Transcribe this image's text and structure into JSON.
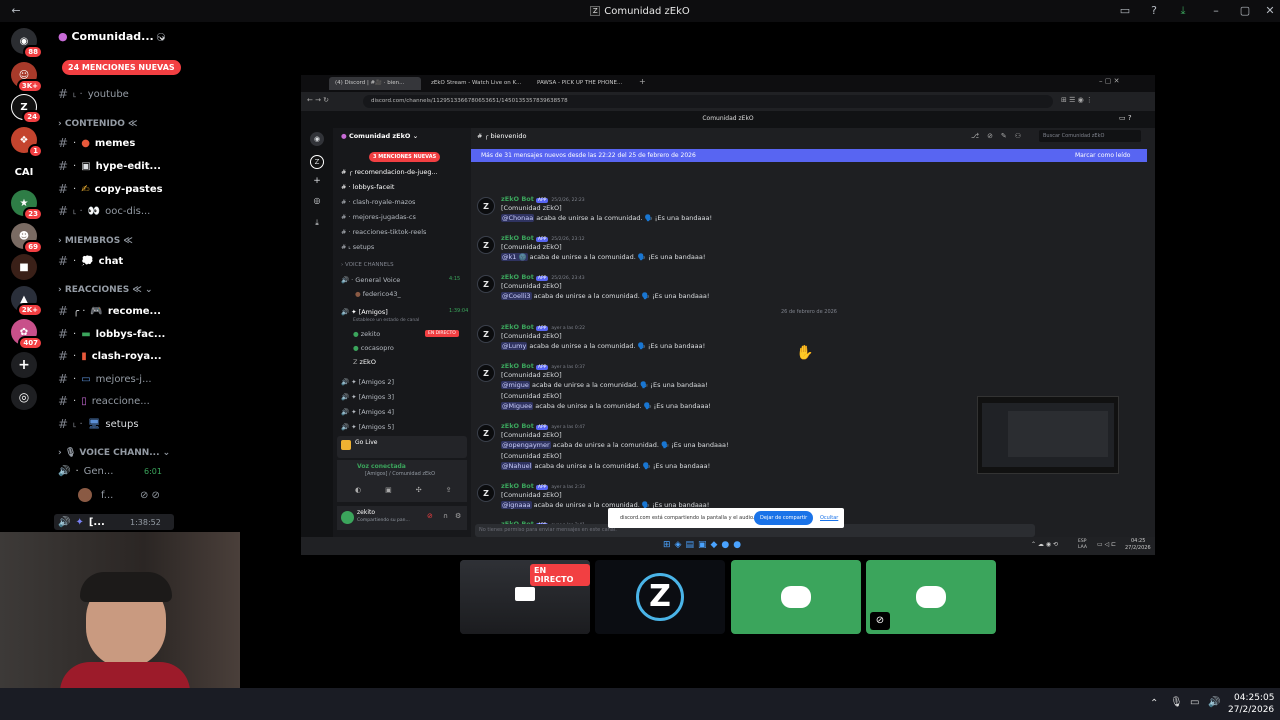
{
  "window": {
    "title": "Comunidad zEkO"
  },
  "server": {
    "name": "Comunidad...",
    "mentions_pill": "24 MENCIONES NUEVAS",
    "rail_badges": [
      "88",
      "3K+",
      "24",
      "1",
      "23",
      "69",
      "2K+",
      "407"
    ],
    "rail_text": "CAI"
  },
  "channels": {
    "youtube": "youtube",
    "cat_contenido": "CONTENIDO",
    "memes": "memes",
    "hype_edit": "hype-edit...",
    "copy_pastes": "copy-pastes",
    "ooc_dis": "ooc-dis...",
    "cat_miembros": "MIEMBROS",
    "chat": "chat",
    "cat_reacciones": "REACCIONES",
    "recome": "recome...",
    "lobbys_fac": "lobbys-fac...",
    "clash_roya": "clash-roya...",
    "mejores_j": "mejores-j...",
    "reaccione": "reaccione...",
    "setups": "setups",
    "cat_voice": "VOICE CHANN...",
    "gen": "Gen...",
    "gen_time": "6:01",
    "f_user": "f...",
    "amigos_short": "[...",
    "amigos_time": "1:38:52"
  },
  "shared": {
    "tabs": [
      "(4) Discord | #🎥 · bien...",
      "zEkO Stream - Watch Live on K...",
      "PAWSA - PICK UP THE PHONE..."
    ],
    "url": "discord.com/channels/1129513366780653651/1450135357839638578",
    "top_title": "Comunidad zEkO",
    "server_name": "Comunidad zEkO",
    "channel_title": "bienvenido",
    "search_placeholder": "Buscar Comunidad zEkO",
    "mentions_pill": "3 MENCIONES NUEVAS",
    "banner": "Más de 31 mensajes nuevos desde las 22:22 del 25 de febrero de 2026",
    "banner_action": "Marcar como leído",
    "date_divider": "26 de febrero de 2026",
    "channel_list": [
      "recomendacion-de-jueg...",
      "lobbys-faceit",
      "clash-royale-mazos",
      "mejores-jugadas-cs",
      "reacciones-tiktok-reels",
      "setups",
      "VOICE CHANNELS",
      "General Voice",
      "federico43_",
      "[Amigos]",
      "Establece un estado de canal",
      "zekito",
      "cocasopro",
      "zEkO",
      "[Amigos 2]",
      "[Amigos 3]",
      "[Amigos 4]",
      "[Amigos 5]"
    ],
    "general_voice_time": "4:15",
    "amigos_time": "1:39:04",
    "en_directo": "EN DIRECTO",
    "go_live": "Go Live",
    "voz_conectada": "Voz conectada",
    "voz_channel": "[Amigos] / Comunidad zEkO",
    "user_name": "zekito",
    "user_status": "Compartiendo su pan...",
    "input_placeholder": "No tienes permiso para enviar mensajes en este canal.",
    "share_notice": "discord.com está compartiendo la pantalla y el audio.",
    "share_stop": "Dejar de compartir",
    "share_hide": "Ocultar",
    "messages": [
      {
        "author": "zEkO Bot",
        "tag": "APP",
        "time": "25/2/26, 22:23",
        "lines": [
          [
            "[Comunidad zEkO]",
            ""
          ],
          [
            "@Chonaa",
            " acaba de unirse a la comunidad. 🗣️ ¡Es una bandaaa!"
          ]
        ]
      },
      {
        "author": "zEkO Bot",
        "tag": "APP",
        "time": "25/2/26, 23:12",
        "lines": [
          [
            "[Comunidad zEkO]",
            ""
          ],
          [
            "@k1 🌚",
            " acaba de unirse a la comunidad. 🗣️ ¡Es una bandaaa!"
          ]
        ]
      },
      {
        "author": "zEkO Bot",
        "tag": "APP",
        "time": "25/2/26, 23:43",
        "lines": [
          [
            "[Comunidad zEkO]",
            ""
          ],
          [
            "@Coelli3",
            " acaba de unirse a la comunidad. 🗣️ ¡Es una bandaaa!"
          ]
        ]
      },
      {
        "author": "zEkO Bot",
        "tag": "APP",
        "time": "ayer a las 0:22",
        "lines": [
          [
            "[Comunidad zEkO]",
            ""
          ],
          [
            "@Lumy",
            " acaba de unirse a la comunidad. 🗣️ ¡Es una bandaaa!"
          ]
        ]
      },
      {
        "author": "zEkO Bot",
        "tag": "APP",
        "time": "ayer a las 0:37",
        "lines": [
          [
            "[Comunidad zEkO]",
            ""
          ],
          [
            "@migue",
            " acaba de unirse a la comunidad. 🗣️ ¡Es una bandaaa!"
          ],
          [
            "[Comunidad zEkO]",
            ""
          ],
          [
            "@Miguee",
            " acaba de unirse a la comunidad. 🗣️ ¡Es una bandaaa!"
          ]
        ]
      },
      {
        "author": "zEkO Bot",
        "tag": "APP",
        "time": "ayer a las 0:47",
        "lines": [
          [
            "[Comunidad zEkO]",
            ""
          ],
          [
            "@opengaymer",
            " acaba de unirse a la comunidad. 🗣️ ¡Es una bandaaa!"
          ],
          [
            "[Comunidad zEkO]",
            ""
          ],
          [
            "@Nahuel",
            " acaba de unirse a la comunidad. 🗣️ ¡Es una bandaaa!"
          ]
        ]
      },
      {
        "author": "zEkO Bot",
        "tag": "APP",
        "time": "ayer a las 2:33",
        "lines": [
          [
            "[Comunidad zEkO]",
            ""
          ],
          [
            "@ignaaa",
            " acaba de unirse a la comunidad. 🗣️ ¡Es una bandaaa!"
          ]
        ]
      },
      {
        "author": "zEkO Bot",
        "tag": "APP",
        "time": "ayer a las 2:41",
        "lines": []
      }
    ],
    "tray_lang": "ESP\nLAA",
    "tray_time": "04:25",
    "tray_date": "27/2/2026"
  },
  "tiles": {
    "live_badge": "EN DIRECTO"
  },
  "taskbar": {
    "time": "04:25:05",
    "date": "27/2/2026"
  },
  "colors": {
    "accent": "#5865f2",
    "green": "#3ba55c",
    "red": "#f23f42"
  }
}
